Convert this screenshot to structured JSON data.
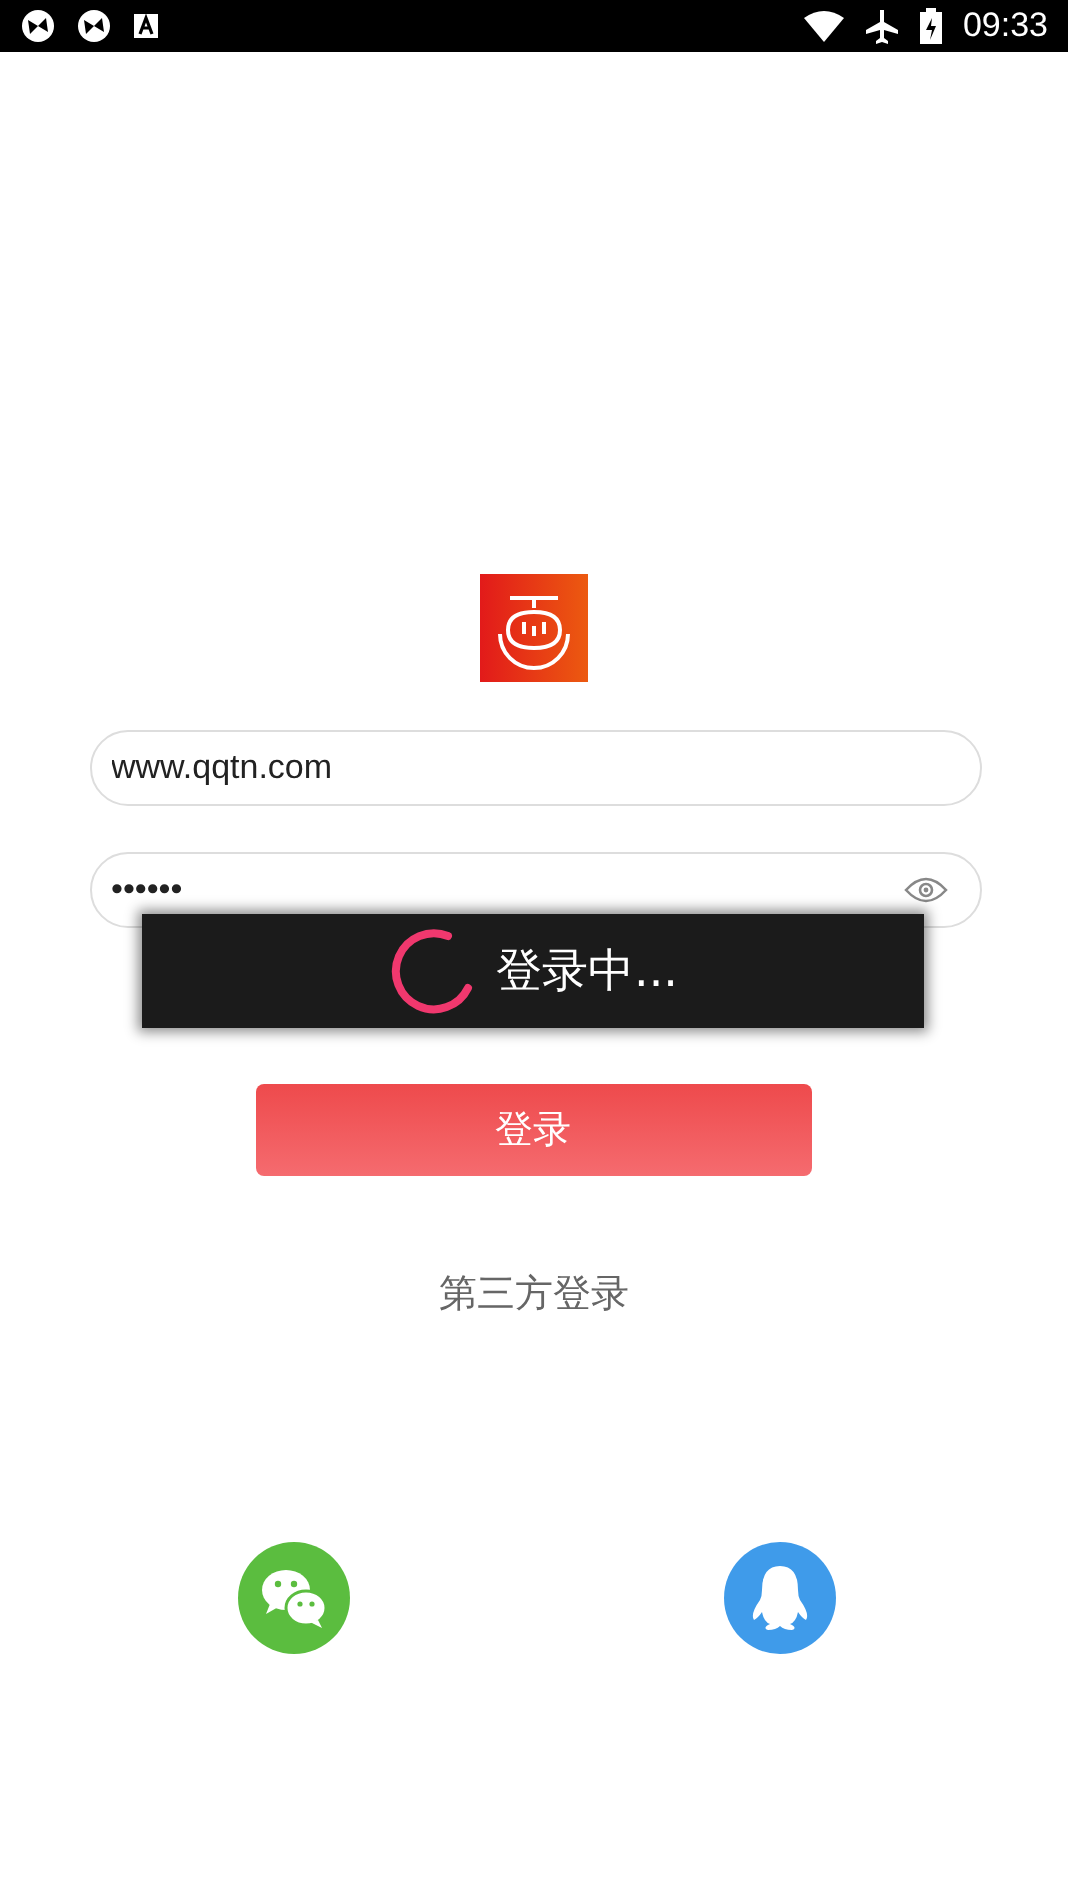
{
  "status_bar": {
    "time": "09:33"
  },
  "username": {
    "value": "www.qqtn.com"
  },
  "password": {
    "value": "••••••"
  },
  "login_button": {
    "label": "登录"
  },
  "third_party": {
    "title": "第三方登录",
    "providers": [
      {
        "kind": "wechat"
      },
      {
        "kind": "qq"
      }
    ]
  },
  "dialog": {
    "visible": true,
    "message": "登录中..."
  }
}
